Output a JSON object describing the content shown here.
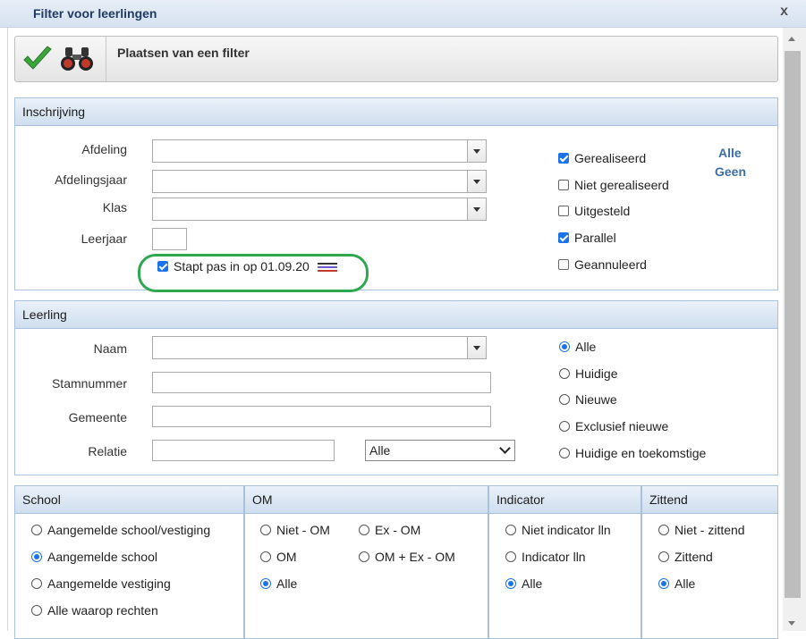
{
  "window": {
    "title": "Filter voor leerlingen",
    "close_label": "x"
  },
  "toolbar": {
    "title": "Plaatsen van een filter"
  },
  "inschrijving": {
    "header": "Inschrijving",
    "labels": {
      "afdeling": "Afdeling",
      "afdelingsjaar": "Afdelingsjaar",
      "klas": "Klas",
      "leerjaar": "Leerjaar"
    },
    "stapt_pas": {
      "label": "Stapt pas in op 01.09.20",
      "checked": true
    },
    "status_options": [
      {
        "label": "Gerealiseerd",
        "checked": true
      },
      {
        "label": "Niet gerealiseerd",
        "checked": false
      },
      {
        "label": "Uitgesteld",
        "checked": false
      },
      {
        "label": "Parallel",
        "checked": true
      },
      {
        "label": "Geannuleerd",
        "checked": false
      }
    ],
    "alle_link": "Alle",
    "geen_link": "Geen"
  },
  "leerling": {
    "header": "Leerling",
    "labels": {
      "naam": "Naam",
      "stamnummer": "Stamnummer",
      "gemeente": "Gemeente",
      "relatie": "Relatie"
    },
    "relatie_select": "Alle",
    "radio_options": [
      {
        "label": "Alle",
        "selected": true
      },
      {
        "label": "Huidige",
        "selected": false
      },
      {
        "label": "Nieuwe",
        "selected": false
      },
      {
        "label": "Exclusief nieuwe",
        "selected": false
      },
      {
        "label": "Huidige en toekomstige",
        "selected": false
      }
    ]
  },
  "school": {
    "header": "School",
    "options": [
      {
        "label": "Aangemelde school/vestiging",
        "selected": false
      },
      {
        "label": "Aangemelde school",
        "selected": true
      },
      {
        "label": "Aangemelde vestiging",
        "selected": false
      },
      {
        "label": "Alle waarop rechten",
        "selected": false
      }
    ]
  },
  "om": {
    "header": "OM",
    "options": [
      {
        "label": "Niet - OM",
        "selected": false
      },
      {
        "label": "Ex - OM",
        "selected": false
      },
      {
        "label": "OM",
        "selected": false
      },
      {
        "label": "OM + Ex - OM",
        "selected": false
      },
      {
        "label": "Alle",
        "selected": true
      }
    ]
  },
  "indicator": {
    "header": "Indicator",
    "options": [
      {
        "label": "Niet indicator lln",
        "selected": false
      },
      {
        "label": "Indicator lln",
        "selected": false
      },
      {
        "label": "Alle",
        "selected": true
      }
    ]
  },
  "zittend": {
    "header": "Zittend",
    "options": [
      {
        "label": "Niet - zittend",
        "selected": false
      },
      {
        "label": "Zittend",
        "selected": false
      },
      {
        "label": "Alle",
        "selected": true
      }
    ]
  }
}
